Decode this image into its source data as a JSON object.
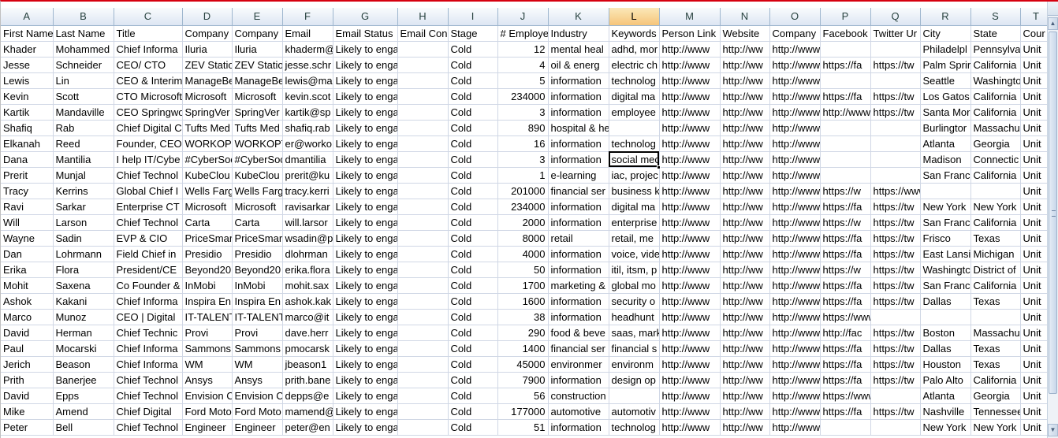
{
  "sheet": {
    "columns": [
      "A",
      "B",
      "C",
      "D",
      "E",
      "F",
      "G",
      "H",
      "I",
      "J",
      "K",
      "L",
      "M",
      "N",
      "O",
      "P",
      "Q",
      "R",
      "S",
      "T"
    ],
    "selected_column": "L",
    "active_cell": {
      "row": 8,
      "col": 11
    },
    "numeric_columns": [
      9
    ],
    "rows": [
      [
        "First Name",
        "Last Name",
        "Title",
        "Company",
        "Company",
        "Email",
        "Email Status",
        "Email Con",
        "Stage",
        "# Employe",
        "Industry",
        "Keywords",
        "Person Link",
        "Website",
        "Company",
        "Facebook",
        "Twitter Ur",
        "City",
        "State",
        "Cour"
      ],
      [
        "Khader",
        "Mohammed",
        "Chief Informa",
        "Iluria",
        "Iluria",
        "khaderm@",
        "Likely to engage",
        "",
        "Cold",
        "12",
        "mental heal",
        "adhd, mor",
        "http://www",
        "http://ww",
        "http://www.linkedin.com/com",
        "",
        "",
        "Philadelpl",
        "Pennsylva",
        "Unit"
      ],
      [
        "Jesse",
        "Schneider",
        "CEO/ CTO",
        "ZEV Statio",
        "ZEV Statio",
        "jesse.schr",
        "Likely to engage",
        "",
        "Cold",
        "4",
        "oil & energ",
        "electric ch",
        "http://www",
        "http://ww",
        "http://www",
        "https://fa",
        "https://tw",
        "Palm Sprir",
        "California",
        "Unit"
      ],
      [
        "Lewis",
        "Lin",
        "CEO & Interim",
        "ManageBe",
        "ManageBe",
        "lewis@ma",
        "Likely to engage",
        "",
        "Cold",
        "5",
        "information",
        "technolog",
        "http://www",
        "http://ww",
        "http://www.linkedin.com/com",
        "",
        "",
        "Seattle",
        "Washingto",
        "Unit"
      ],
      [
        "Kevin",
        "Scott",
        "CTO Microsoft",
        "Microsoft",
        "Microsoft",
        "kevin.scot",
        "Likely to engage",
        "",
        "Cold",
        "234000",
        "information",
        "digital ma",
        "http://www",
        "http://ww",
        "http://www",
        "https://fa",
        "https://tw",
        "Los Gatos",
        "California",
        "Unit"
      ],
      [
        "Kartik",
        "Mandaville",
        "CEO Springwo",
        "SpringVer",
        "SpringVer",
        "kartik@sp",
        "Likely to engage",
        "",
        "Cold",
        "3",
        "information",
        "employee",
        "http://www",
        "http://ww",
        "http://www",
        "http://www.linkedir",
        "https://tw",
        "Santa Mor",
        "California",
        "Unit"
      ],
      [
        "Shafiq",
        "Rab",
        "Chief Digital C",
        "Tufts Med",
        "Tufts Med",
        "shafiq.rab",
        "Likely to engage",
        "",
        "Cold",
        "890",
        "hospital & health care",
        "",
        "http://www",
        "http://ww",
        "http://www.linkedin.com/com",
        "",
        "",
        "Burlingtor",
        "Massachu",
        "Unit"
      ],
      [
        "Elkanah",
        "Reed",
        "Founder, CEO",
        "WORKOPT",
        "WORKOPT",
        "er@worko",
        "Likely to engage",
        "",
        "Cold",
        "16",
        "information",
        "technolog",
        "http://www",
        "http://ww",
        "http://www.linkedin.com/com",
        "",
        "",
        "Atlanta",
        "Georgia",
        "Unit"
      ],
      [
        "Dana",
        "Mantilia",
        "I help IT/Cybe",
        "#CyberSoc",
        "#CyberSoc",
        "dmantilia",
        "Likely to engage",
        "",
        "Cold",
        "3",
        "information",
        "social mec",
        "http://www",
        "http://ww",
        "http://www.linkedin.com/com",
        "",
        "",
        "Madison",
        "Connectic",
        "Unit"
      ],
      [
        "Prerit",
        "Munjal",
        "Chief Technol",
        "KubeClou",
        "KubeClou",
        "prerit@ku",
        "Likely to engage",
        "",
        "Cold",
        "1",
        "e-learning",
        "iac, projec",
        "http://www",
        "http://ww",
        "http://www.linkedin.com/com",
        "",
        "",
        "San Franci",
        "California",
        "Unit"
      ],
      [
        "Tracy",
        "Kerrins",
        "Global Chief I",
        "Wells Farg",
        "Wells Farg",
        "tracy.kerri",
        "Likely to engage",
        "",
        "Cold",
        "201000",
        "financial ser",
        "business k",
        "http://www",
        "http://ww",
        "http://www",
        "https://w",
        "https://www.twitter.com/well",
        "",
        "",
        "Unit"
      ],
      [
        "Ravi",
        "Sarkar",
        "Enterprise CT",
        "Microsoft",
        "Microsoft",
        "ravisarkar",
        "Likely to engage",
        "",
        "Cold",
        "234000",
        "information",
        "digital ma",
        "http://www",
        "http://ww",
        "http://www",
        "https://fa",
        "https://tw",
        "New York",
        "New York",
        "Unit"
      ],
      [
        "Will",
        "Larson",
        "Chief Technol",
        "Carta",
        "Carta",
        "will.larsor",
        "Likely to engage",
        "",
        "Cold",
        "2000",
        "information",
        "enterprise",
        "http://www",
        "http://ww",
        "http://www",
        "https://w",
        "https://tw",
        "San Franci",
        "California",
        "Unit"
      ],
      [
        "Wayne",
        "Sadin",
        "EVP & CIO",
        "PriceSmar",
        "PriceSmar",
        "wsadin@p",
        "Likely to engage",
        "",
        "Cold",
        "8000",
        "retail",
        "retail, me",
        "http://www",
        "http://ww",
        "http://www",
        "https://fa",
        "https://tw",
        "Frisco",
        "Texas",
        "Unit"
      ],
      [
        "Dan",
        "Lohrmann",
        "Field Chief in",
        "Presidio",
        "Presidio",
        "dlohrman",
        "Likely to engage",
        "",
        "Cold",
        "4000",
        "information",
        "voice, vide",
        "http://www",
        "http://ww",
        "http://www",
        "https://fa",
        "https://tw",
        "East Lansi",
        "Michigan",
        "Unit"
      ],
      [
        "Erika",
        "Flora",
        "President/CE",
        "Beyond20",
        "Beyond20",
        "erika.flora",
        "Likely to engage",
        "",
        "Cold",
        "50",
        "information",
        "itil, itsm, p",
        "http://www",
        "http://ww",
        "http://www",
        "https://w",
        "https://tw",
        "Washingtc",
        "District of",
        "Unit"
      ],
      [
        "Mohit",
        "Saxena",
        "Co Founder &",
        "InMobi",
        "InMobi",
        "mohit.sax",
        "Likely to engage",
        "",
        "Cold",
        "1700",
        "marketing &",
        "global mo",
        "http://www",
        "http://ww",
        "http://www",
        "https://fa",
        "https://tw",
        "San Franci",
        "California",
        "Unit"
      ],
      [
        "Ashok",
        "Kakani",
        "Chief Informa",
        "Inspira En",
        "Inspira En",
        "ashok.kak",
        "Likely to engage",
        "",
        "Cold",
        "1600",
        "information",
        "security o",
        "http://www",
        "http://ww",
        "http://www",
        "https://fa",
        "https://tw",
        "Dallas",
        "Texas",
        "Unit"
      ],
      [
        "Marco",
        "Munoz",
        "CEO | Digital",
        "IT-TALENT",
        "IT-TALENT",
        "marco@it",
        "Likely to engage",
        "",
        "Cold",
        "38",
        "information",
        "headhunt",
        "http://www",
        "http://ww",
        "http://www",
        "https://www.facebook.com/itthgroup/",
        "",
        "",
        "",
        "Unit"
      ],
      [
        "David",
        "Herman",
        "Chief Technic",
        "Provi",
        "Provi",
        "dave.herr",
        "Likely to engage",
        "",
        "Cold",
        "290",
        "food & beve",
        "saas, mark",
        "http://www",
        "http://ww",
        "http://www",
        "http://fac",
        "https://tw",
        "Boston",
        "Massachu",
        "Unit"
      ],
      [
        "Paul",
        "Mocarski",
        "Chief Informa",
        "Sammons",
        "Sammons",
        "pmocarsk",
        "Likely to engage",
        "",
        "Cold",
        "1400",
        "financial ser",
        "financial s",
        "http://www",
        "http://ww",
        "http://www",
        "https://fa",
        "https://tw",
        "Dallas",
        "Texas",
        "Unit"
      ],
      [
        "Jerich",
        "Beason",
        "Chief Informa",
        "WM",
        "WM",
        "jbeason1",
        "Likely to engage",
        "",
        "Cold",
        "45000",
        "environmer",
        "environm",
        "http://www",
        "http://ww",
        "http://www",
        "https://fa",
        "https://tw",
        "Houston",
        "Texas",
        "Unit"
      ],
      [
        "Prith",
        "Banerjee",
        "Chief Technol",
        "Ansys",
        "Ansys",
        "prith.bane",
        "Likely to engage",
        "",
        "Cold",
        "7900",
        "information",
        "design op",
        "http://www",
        "http://ww",
        "http://www",
        "https://fa",
        "https://tw",
        "Palo Alto",
        "California",
        "Unit"
      ],
      [
        "David",
        "Epps",
        "Chief Technol",
        "Envision C",
        "Envision C",
        "depps@e",
        "Likely to engage",
        "",
        "Cold",
        "56",
        "construction",
        "",
        "http://www",
        "http://ww",
        "http://www",
        "https://www.facebc",
        "",
        "Atlanta",
        "Georgia",
        "Unit"
      ],
      [
        "Mike",
        "Amend",
        "Chief Digital",
        "Ford Moto",
        "Ford Moto",
        "mamend@",
        "Likely to engage",
        "",
        "Cold",
        "177000",
        "automotive",
        "automotiv",
        "http://www",
        "http://ww",
        "http://www",
        "https://fa",
        "https://tw",
        "Nashville",
        "Tennessee",
        "Unit"
      ],
      [
        "Peter",
        "Bell",
        "Chief Technol",
        "Engineer",
        "Engineer",
        "peter@en",
        "Likely to engage",
        "",
        "Cold",
        "51",
        "information",
        "technolog",
        "http://www",
        "http://ww",
        "http://www.linkedin.com/com",
        "",
        "",
        "New York",
        "New York",
        "Unit"
      ]
    ]
  },
  "scrollbar": {
    "position": 0.0
  }
}
